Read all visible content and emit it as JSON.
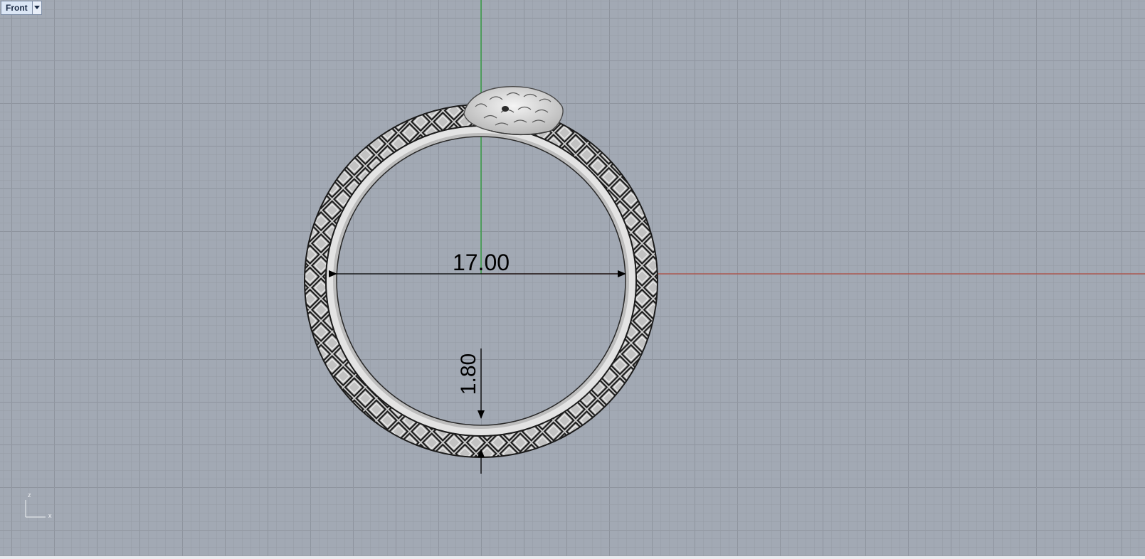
{
  "viewport": {
    "name": "Front",
    "menu_icon": "dropdown-arrow-icon"
  },
  "dimensions": {
    "diameter": "17.00",
    "thickness": "1.80"
  },
  "axis_widget": {
    "z_label": "z",
    "x_label": "x"
  },
  "colors": {
    "background": "#a2a9b4",
    "x_axis": "#b04a3e",
    "z_axis": "#1f9d2c",
    "model": "#d8d8d8",
    "model_edges": "#1b1b1b"
  }
}
